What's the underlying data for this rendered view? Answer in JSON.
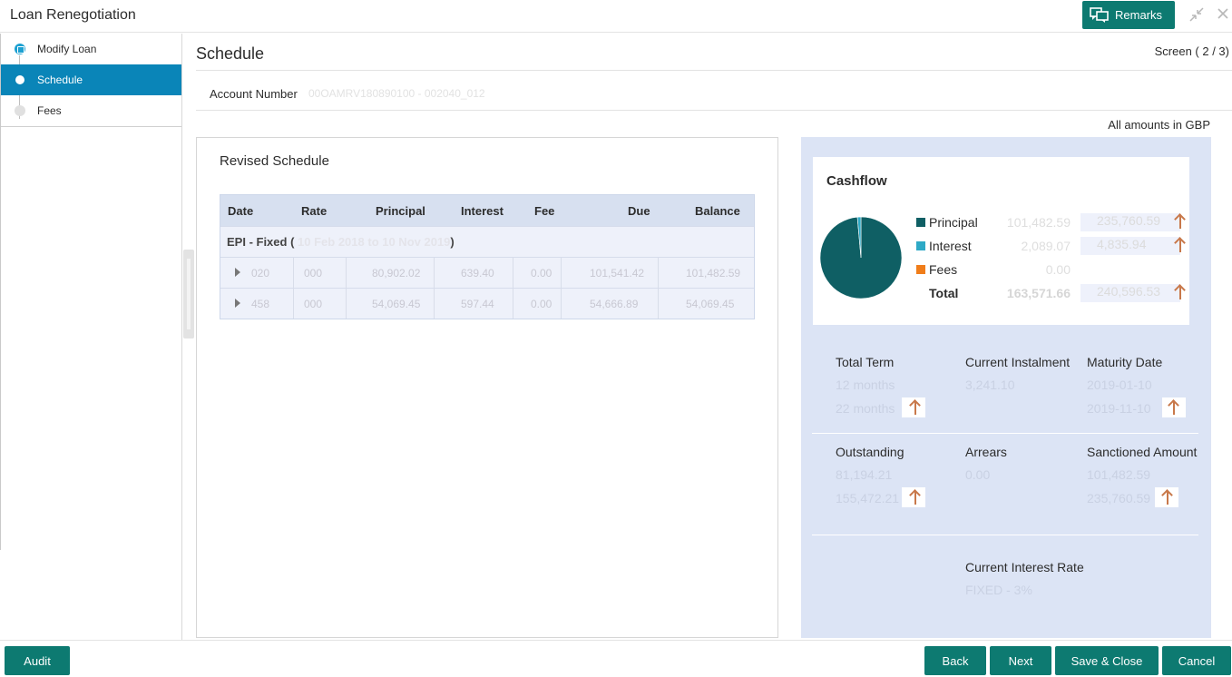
{
  "window": {
    "title": "Loan Renegotiation",
    "remarks_label": "Remarks"
  },
  "sidebar": {
    "items": [
      {
        "label": "Modify Loan",
        "state": "done"
      },
      {
        "label": "Schedule",
        "state": "active"
      },
      {
        "label": "Fees",
        "state": "pending"
      }
    ]
  },
  "screen": {
    "title": "Schedule",
    "counter": "Screen ( 2 / 3)",
    "account_label": "Account Number",
    "account_value": "00OAMRV180890100 - 002040_012",
    "amounts_note": "All amounts in GBP"
  },
  "schedule": {
    "title": "Revised Schedule",
    "columns": [
      "Date",
      "Rate",
      "Principal",
      "Interest",
      "Fee",
      "Due",
      "Balance"
    ],
    "group_prefix": "EPI - Fixed (",
    "group_range": "10 Feb 2018 to 10 Nov 2019",
    "group_suffix": " )",
    "rows": [
      {
        "date": "020",
        "rate": "000",
        "principal": "80,902.02",
        "interest": "639.40",
        "fee": "0.00",
        "due": "101,541.42",
        "balance": "101,482.59"
      },
      {
        "date": "458",
        "rate": "000",
        "principal": "54,069.45",
        "interest": "597.44",
        "fee": "0.00",
        "due": "54,666.89",
        "balance": "54,069.45"
      }
    ]
  },
  "cashflow": {
    "title": "Cashflow",
    "colors": {
      "principal": "#0f5f64",
      "interest": "#2ea9c6",
      "fees": "#f07d1a"
    },
    "legend": [
      {
        "label": "Principal",
        "current": "101,482.59",
        "revised": "235,760.59"
      },
      {
        "label": "Interest",
        "current": "2,089.07",
        "revised": "4,835.94"
      },
      {
        "label": "Fees",
        "current": "0.00",
        "revised": ""
      }
    ],
    "total_label": "Total",
    "total_current": "163,571.66",
    "total_revised": "240,596.53",
    "pie_principal_fraction": 0.986
  },
  "stats": {
    "total_term_label": "Total Term",
    "total_term_current": "12 months",
    "total_term_revised": "22 months",
    "current_instalment_label": "Current Instalment",
    "current_instalment_value": "3,241.10",
    "maturity_label": "Maturity Date",
    "maturity_current": "2019-01-10",
    "maturity_revised": "2019-11-10",
    "outstanding_label": "Outstanding",
    "outstanding_current": "81,194.21",
    "outstanding_revised": "155,472.21",
    "arrears_label": "Arrears",
    "arrears_value": "0.00",
    "sanctioned_label": "Sanctioned Amount",
    "sanctioned_current": "101,482.59",
    "sanctioned_revised": "235,760.59",
    "interest_rate_label": "Current Interest Rate",
    "interest_rate_value": "FIXED - 3%"
  },
  "footer": {
    "audit": "Audit",
    "back": "Back",
    "next": "Next",
    "save_close": "Save & Close",
    "cancel": "Cancel"
  }
}
